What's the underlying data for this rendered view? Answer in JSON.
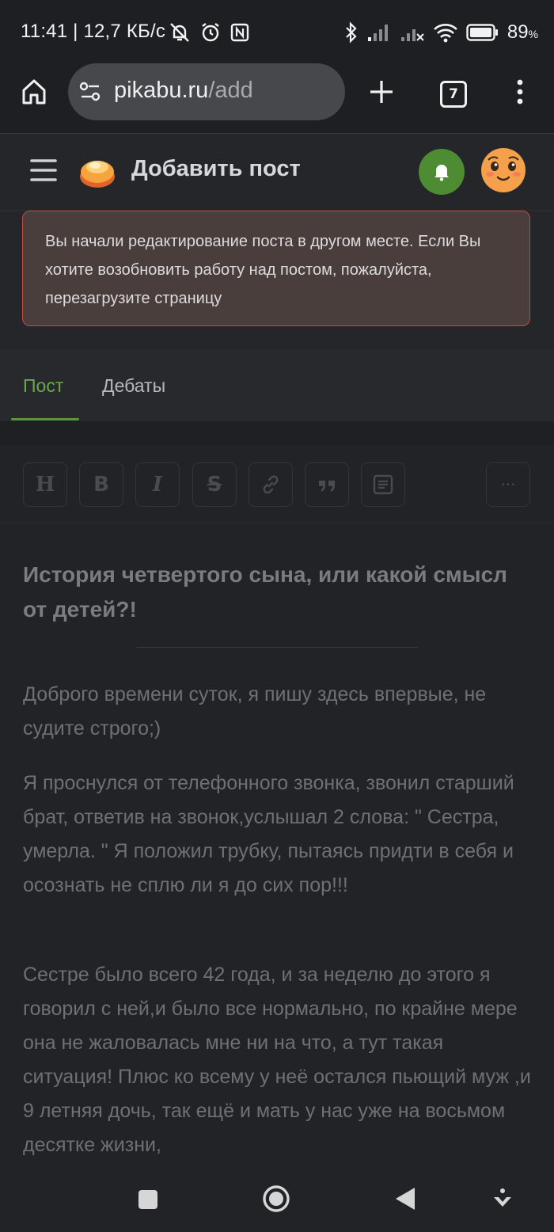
{
  "status_bar": {
    "time_speed": "11:41 | 12,7 КБ/с",
    "battery": "89",
    "battery_unit": "%"
  },
  "browser": {
    "url_host": "pikabu.ru",
    "url_path": "/add",
    "tab_count": "7"
  },
  "header": {
    "title": "Добавить пост"
  },
  "notice": {
    "text": "Вы начали редактирование поста в другом месте. Если Вы хотите возобновить работу над постом, пожалуйста, перезагрузите страницу"
  },
  "tabs": [
    {
      "label": "Пост",
      "active": true
    },
    {
      "label": "Дебаты",
      "active": false
    }
  ],
  "toolbar": {
    "heading": "H",
    "bold": "B",
    "italic": "I",
    "strike": "S",
    "more": "···"
  },
  "post": {
    "title": "История четвертого сына, или какой смысл от детей?!",
    "paragraphs": [
      "Доброго времени суток, я пишу здесь впервые, не судите строго;)",
      "Я проснулся от телефонного звонка, звонил старший брат, ответив на звонок,услышал 2 слова: \" Сестра, умерла. \" Я положил трубку, пытаясь придти в себя и осознать не сплю ли я до сих пор!!!",
      "Сестре было всего 42 года, и за неделю до этого я говорил с ней,и было все нормально, по крайне мере она не жаловалась мне ни на что, а тут такая ситуация! Плюс ко всему у неё остался пьющий муж ,и 9 летняя дочь, так ещё и мать у нас уже на восьмом десятке жизни,"
    ]
  },
  "colors": {
    "accent_green": "#6aa84f",
    "notice_border": "#c54a40",
    "avatar": "#f5a04a"
  }
}
